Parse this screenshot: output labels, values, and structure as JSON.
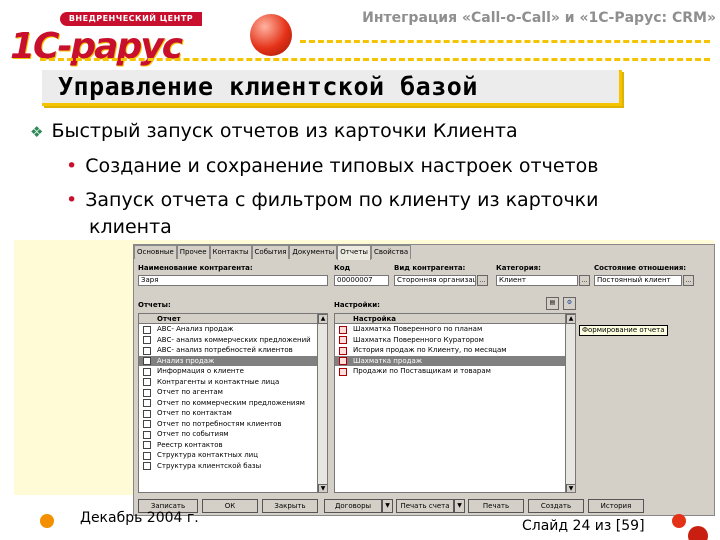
{
  "header": {
    "logo_band": "ВНЕДРЕНЧЕСКИЙ ЦЕНТР",
    "logo_mark": "1С-рарус",
    "title": "Интеграция «Call-o-Call» и «1С-Рарус: CRM»"
  },
  "slide": {
    "heading": "Управление клиентской базой",
    "bullet": "Быстрый запуск отчетов из карточки Клиента",
    "subbullets": [
      "Создание и сохранение  типовых настроек отчетов",
      "Запуск отчета с фильтром по клиенту из карточки"
    ],
    "sub2_cont": "клиента",
    "footer_date": "Декабрь 2004 г.",
    "footer_slide": "Слайд 24 из [59]"
  },
  "window": {
    "tabs": [
      "Основные",
      "Прочее",
      "Контакты",
      "События",
      "Документы",
      "Отчеты",
      "Свойства"
    ],
    "active_tab": "Отчеты",
    "fields": {
      "name_label": "Наименование контрагента:",
      "name_value": "Заря",
      "code_label": "Код",
      "code_value": "00000007",
      "type_label": "Вид контрагента:",
      "type_value": "Сторонняя организация",
      "cat_label": "Категория:",
      "cat_value": "Клиент",
      "status_label": "Состояние отношения:",
      "status_value": "Постоянный клиент"
    },
    "reports_label": "Отчеты:",
    "settings_label": "Настройки:",
    "reports_header": "Отчет",
    "reports": [
      "ABC- Анализ продаж",
      "ABC- анализ коммерческих предложений",
      "ABC- анализ потребностей клиентов",
      "Анализ продаж",
      "Информация о клиенте",
      "Контрагенты и контактные лица",
      "Отчет по агентам",
      "Отчет по коммерческим предложениям",
      "Отчет по контактам",
      "Отчет по потребностям клиентов",
      "Отчет по событиям",
      "Реестр контактов",
      "Структура контактных лиц",
      "Структура клиентской базы"
    ],
    "selected_report_index": 3,
    "settings_header": "Настройка",
    "settings": [
      "Шахматка Поверенного по планам",
      "Шахматка Поверенного Куратором",
      "История продаж по Клиенту, по месяцам",
      "Шахматка продаж",
      "Продажи по Поставщикам и товарам"
    ],
    "selected_setting_index": 3,
    "tooltip": "Формирование отчета",
    "buttons": [
      "Записать",
      "ОК",
      "Закрыть",
      "Договоры",
      "Печать счета",
      "Печать",
      "Создать",
      "История"
    ]
  },
  "colors": {
    "accent_yellow": "#f5c300",
    "brand_red": "#c8102e",
    "bullet_green": "#2e8b57"
  }
}
